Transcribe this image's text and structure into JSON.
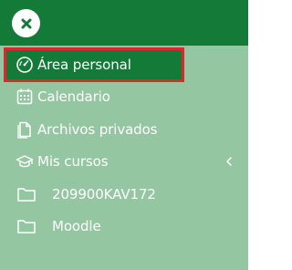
{
  "colors": {
    "header": "#137a37",
    "drawer_bg": "#95c6a2",
    "active_item": "#137a37",
    "highlight_border": "#e0262b",
    "text": "#ffffff"
  },
  "nav": {
    "items": [
      {
        "label": "Área personal",
        "icon": "dashboard-gauge-icon",
        "active": true
      },
      {
        "label": "Calendario",
        "icon": "calendar-icon"
      },
      {
        "label": "Archivos privados",
        "icon": "file-icon"
      },
      {
        "label": "Mis cursos",
        "icon": "graduation-cap-icon",
        "expandable": true,
        "chevron": "chevron-left-icon"
      },
      {
        "label": "209900KAV172",
        "icon": "folder-icon"
      },
      {
        "label": "Moodle",
        "icon": "folder-icon"
      }
    ]
  },
  "header": {
    "close_icon": "close-icon"
  }
}
